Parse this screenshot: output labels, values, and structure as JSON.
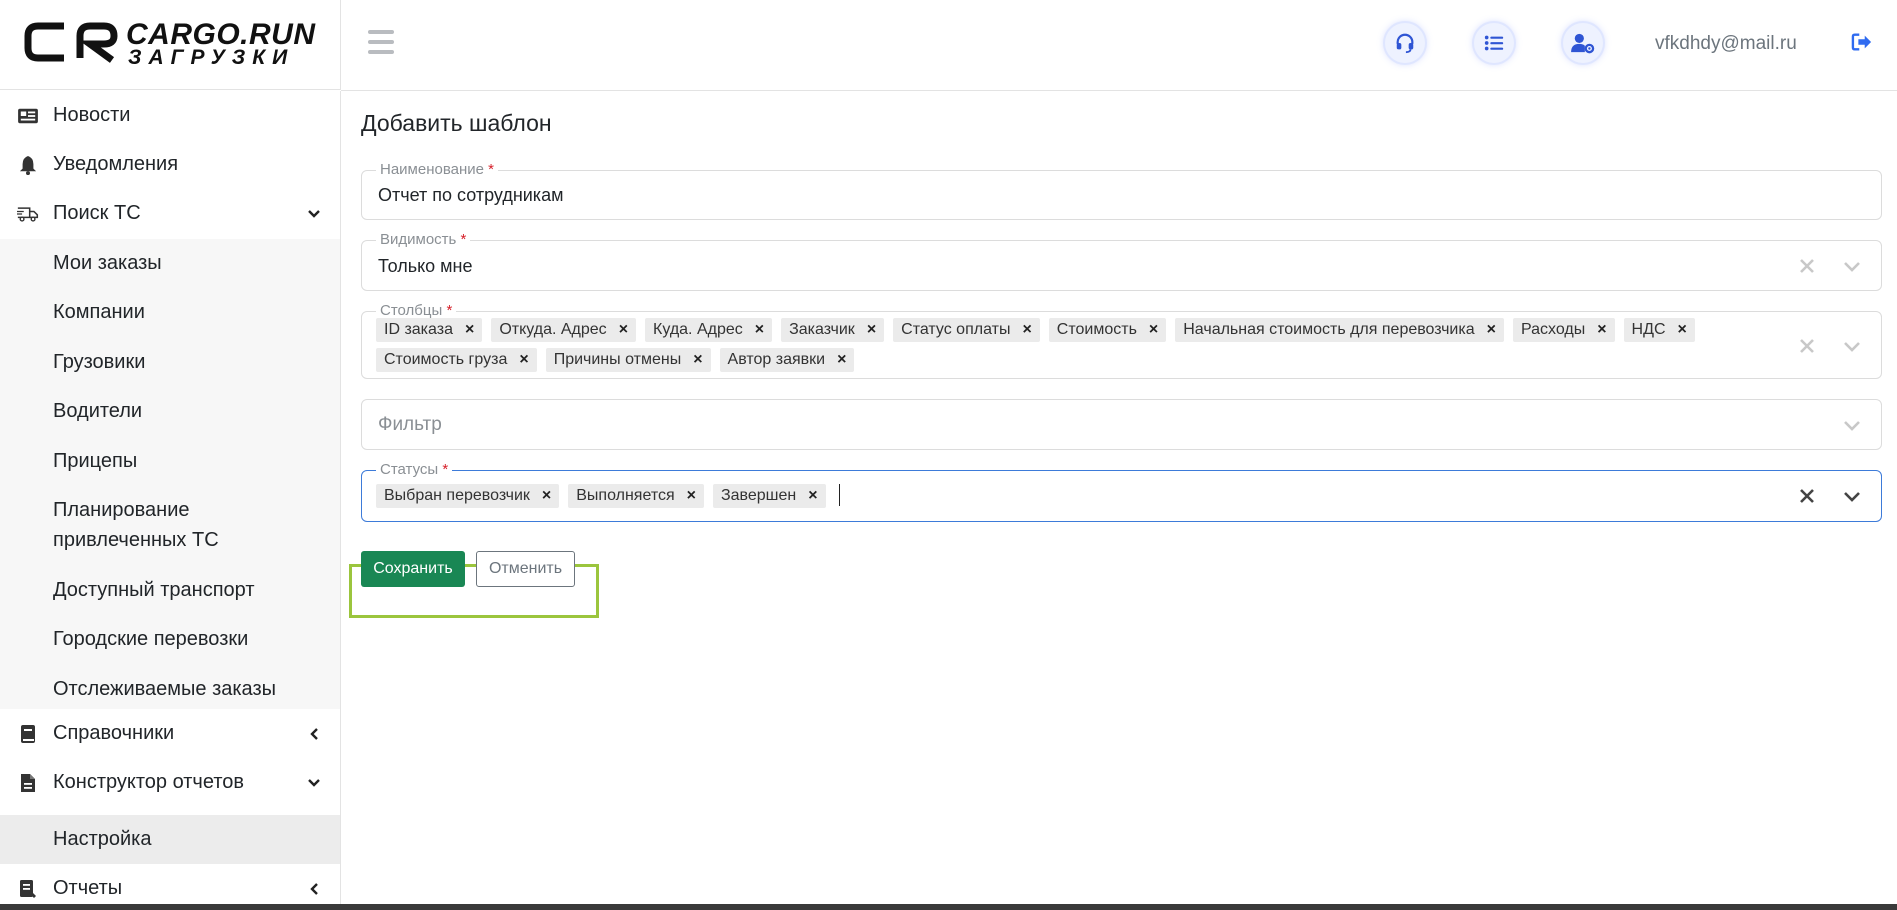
{
  "logo": {
    "title": "CARGO.RUN",
    "subtitle": "ЗАГРУЗКИ"
  },
  "header": {
    "icons": [
      "headset-icon",
      "list-icon",
      "user-settings-icon"
    ],
    "user_email": "vfkdhdy@mail.ru",
    "logout_icon": "sign-out-icon"
  },
  "sidebar": {
    "items": [
      {
        "label": "Новости",
        "icon": "newspaper-icon"
      },
      {
        "label": "Уведомления",
        "icon": "bell-icon"
      },
      {
        "label": "Поиск ТС",
        "icon": "truck-icon",
        "chevron": "down"
      },
      {
        "label": "Справочники",
        "icon": "book-icon",
        "chevron": "left"
      },
      {
        "label": "Конструктор отчетов",
        "icon": "file-icon",
        "chevron": "down"
      },
      {
        "label": "Отчеты",
        "icon": "report-icon",
        "chevron": "left"
      }
    ],
    "search_submenu": [
      "Мои заказы",
      "Компании",
      "Грузовики",
      "Водители",
      "Прицепы",
      "Планирование",
      "привлеченных ТС",
      "Доступный транспорт",
      "Городские перевозки",
      "Отслеживаемые заказы"
    ],
    "constructor_submenu": [
      "Настройка"
    ]
  },
  "main": {
    "title": "Добавить шаблон",
    "name_field": {
      "label": "Наименование",
      "value": "Отчет по сотрудникам"
    },
    "visibility_field": {
      "label": "Видимость",
      "value": "Только мне"
    },
    "columns_field": {
      "label": "Столбцы",
      "chips_row1": [
        "ID заказа",
        "Откуда. Адрес",
        "Куда. Адрес",
        "Заказчик",
        "Статус оплаты",
        "Стоимость",
        "Начальная стоимость для перевозчика",
        "Расходы",
        "НДС"
      ],
      "chips_row2": [
        "Стоимость груза",
        "Причины отмены",
        "Автор заявки"
      ]
    },
    "filter_field": {
      "placeholder": "Фильтр"
    },
    "statuses_field": {
      "label": "Статусы",
      "chips": [
        "Выбран перевозчик",
        "Выполняется",
        "Завершен"
      ]
    },
    "required_mark": "*",
    "chip_remove": "×",
    "save_label": "Сохранить",
    "cancel_label": "Отменить"
  },
  "colors": {
    "save": "#198754",
    "highlight": "#9bc53d",
    "focus": "#3d7bd9",
    "required": "#d6202a"
  }
}
